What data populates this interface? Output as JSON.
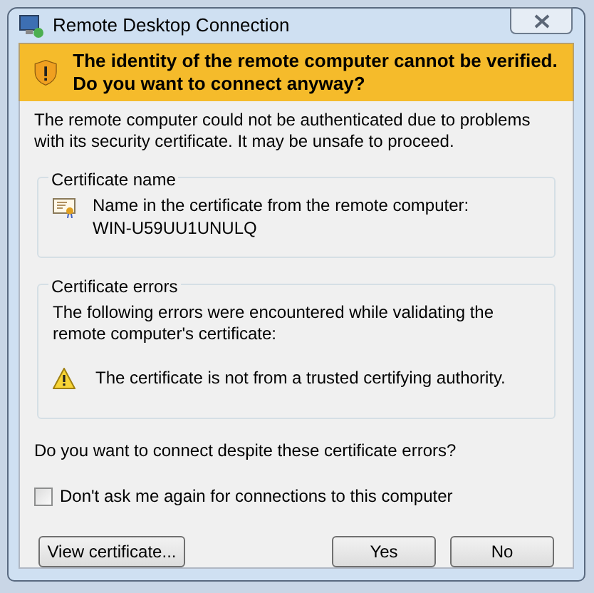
{
  "window": {
    "title": "Remote Desktop Connection"
  },
  "banner": {
    "text": "The identity of the remote computer cannot be verified. Do you want to connect anyway?"
  },
  "intro": "The remote computer could not be authenticated due to problems with its security certificate. It may be unsafe to proceed.",
  "certificate_name": {
    "heading": "Certificate name",
    "label": "Name in the certificate from the remote computer:",
    "value": "WIN-U59UU1UNULQ"
  },
  "certificate_errors": {
    "heading": "Certificate errors",
    "description": "The following errors were encountered while validating the remote computer's certificate:",
    "errors": [
      "The certificate is not from a trusted certifying authority."
    ]
  },
  "question": "Do you want to connect despite these certificate errors?",
  "dont_ask": {
    "label": "Don't ask me again for connections to this computer",
    "checked": false
  },
  "buttons": [
    "View certificate...",
    "Yes",
    "No"
  ]
}
